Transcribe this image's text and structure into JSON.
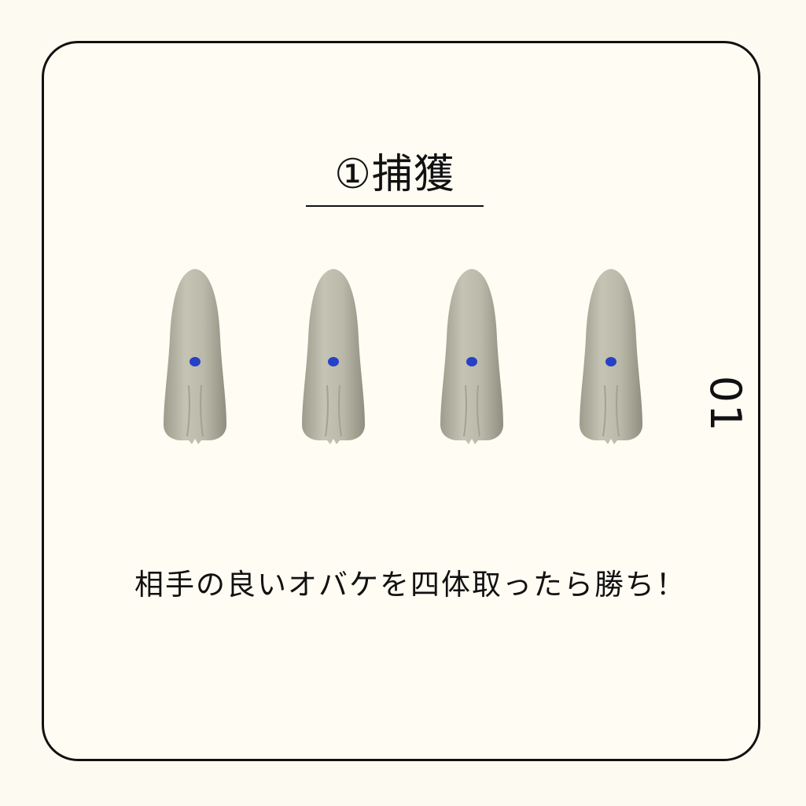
{
  "title": "①捕獲",
  "caption": "相手の良いオバケを四体取ったら勝ち！",
  "page_number": "01",
  "ghosts": [
    {
      "marker": "blue-dot"
    },
    {
      "marker": "blue-dot"
    },
    {
      "marker": "blue-dot"
    },
    {
      "marker": "blue-dot"
    }
  ],
  "colors": {
    "background": "#fdfbf1",
    "border": "#111111",
    "ghost_body": "#b9b8a8",
    "marker": "#2641c6"
  }
}
